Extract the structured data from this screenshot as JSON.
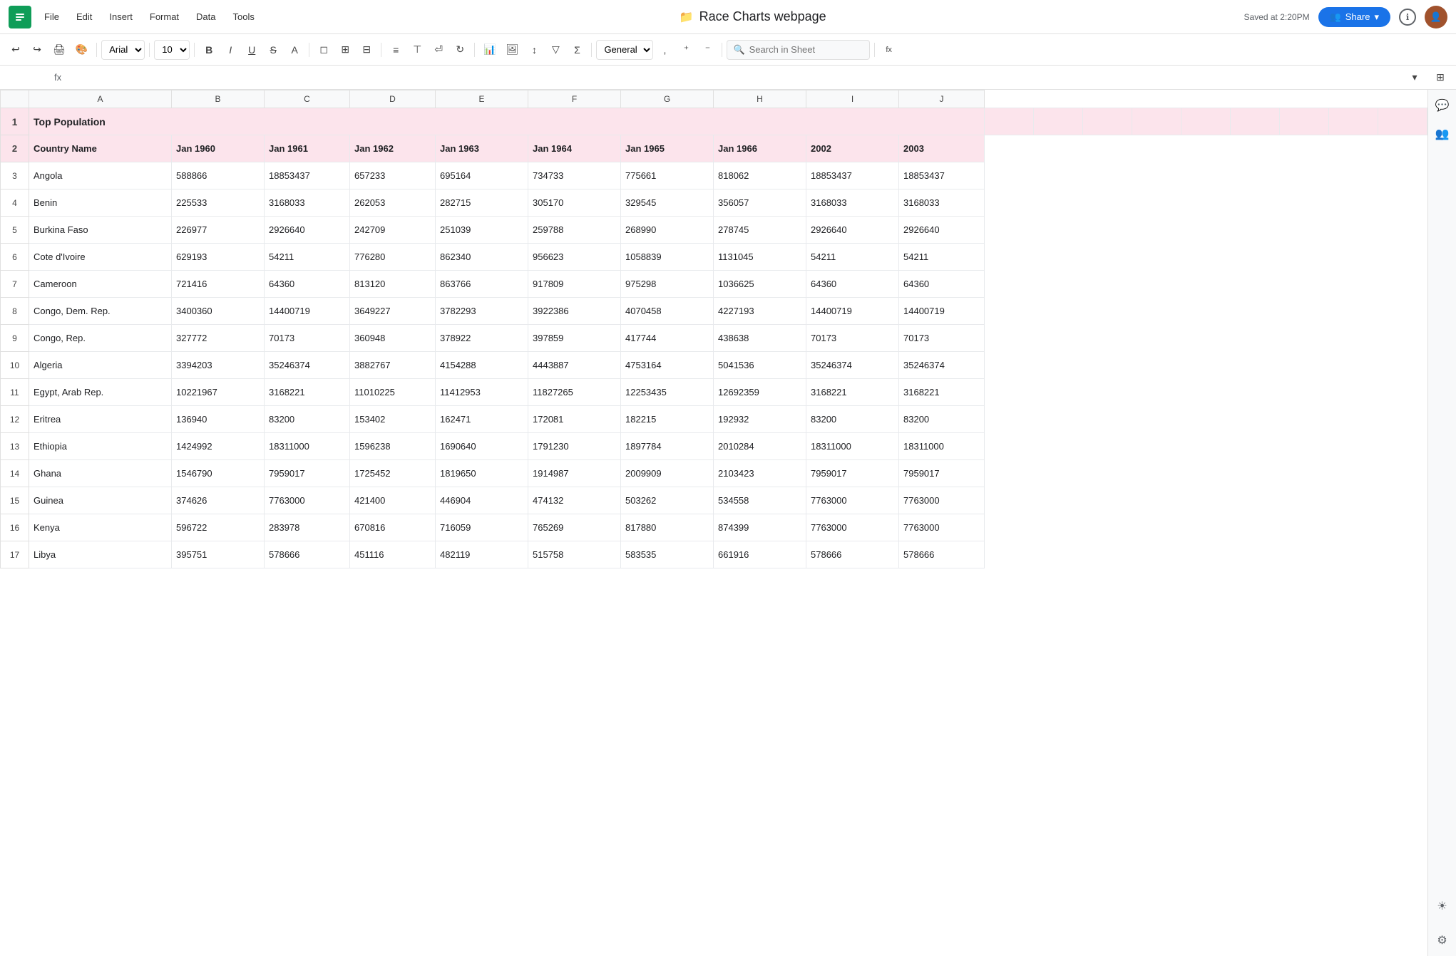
{
  "app": {
    "logo": "S",
    "menu": [
      "File",
      "Edit",
      "Insert",
      "Format",
      "Data",
      "Tools"
    ],
    "title": "Race Charts webpage",
    "saved": "Saved at 2:20PM",
    "share_label": "Share",
    "info_icon": "ℹ",
    "search_placeholder": "Search in Sheet"
  },
  "toolbar": {
    "undo": "↩",
    "redo": "↪",
    "print": "🖨",
    "paint": "🎨",
    "font": "Arial",
    "font_size": "10",
    "bold": "B",
    "italic": "I",
    "underline": "U",
    "strikethrough": "S",
    "text_color": "A",
    "fill_color": "◻",
    "borders": "⊞",
    "merge": "⊟",
    "align": "≡",
    "valign": "⊤",
    "wrap": "⏎",
    "rotate": "↻",
    "more_formats": "...",
    "filter": "▽",
    "sum": "Σ",
    "format_type": "General",
    "fx_label": "fx"
  },
  "columns": {
    "row_header": "",
    "cols": [
      "A",
      "B",
      "C",
      "D",
      "E",
      "F",
      "G",
      "H",
      "I",
      "J"
    ]
  },
  "rows": [
    {
      "row_num": "1",
      "type": "title",
      "cells": [
        "Top Population",
        "",
        "",
        "",
        "",
        "",
        "",
        "",
        "",
        ""
      ]
    },
    {
      "row_num": "2",
      "type": "header",
      "cells": [
        "Country Name",
        "Jan 1960",
        "Jan 1961",
        "Jan 1962",
        "Jan 1963",
        "Jan 1964",
        "Jan 1965",
        "Jan 1966",
        "2002",
        "2003"
      ]
    },
    {
      "row_num": "3",
      "type": "data",
      "cells": [
        "Angola",
        "588866",
        "18853437",
        "657233",
        "695164",
        "734733",
        "775661",
        "818062",
        "18853437",
        "18853437"
      ]
    },
    {
      "row_num": "4",
      "type": "data",
      "cells": [
        "Benin",
        "225533",
        "3168033",
        "262053",
        "282715",
        "305170",
        "329545",
        "356057",
        "3168033",
        "3168033"
      ]
    },
    {
      "row_num": "5",
      "type": "data",
      "cells": [
        "Burkina Faso",
        "226977",
        "2926640",
        "242709",
        "251039",
        "259788",
        "268990",
        "278745",
        "2926640",
        "2926640"
      ]
    },
    {
      "row_num": "6",
      "type": "data",
      "cells": [
        "Cote d'Ivoire",
        "629193",
        "54211",
        "776280",
        "862340",
        "956623",
        "1058839",
        "1131045",
        "54211",
        "54211"
      ]
    },
    {
      "row_num": "7",
      "type": "data",
      "cells": [
        "Cameroon",
        "721416",
        "64360",
        "813120",
        "863766",
        "917809",
        "975298",
        "1036625",
        "64360",
        "64360"
      ]
    },
    {
      "row_num": "8",
      "type": "data",
      "cells": [
        "Congo, Dem. Rep.",
        "3400360",
        "14400719",
        "3649227",
        "3782293",
        "3922386",
        "4070458",
        "4227193",
        "14400719",
        "14400719"
      ]
    },
    {
      "row_num": "9",
      "type": "data",
      "cells": [
        "Congo, Rep.",
        "327772",
        "70173",
        "360948",
        "378922",
        "397859",
        "417744",
        "438638",
        "70173",
        "70173"
      ]
    },
    {
      "row_num": "10",
      "type": "data",
      "cells": [
        "Algeria",
        "3394203",
        "35246374",
        "3882767",
        "4154288",
        "4443887",
        "4753164",
        "5041536",
        "35246374",
        "35246374"
      ]
    },
    {
      "row_num": "11",
      "type": "data",
      "cells": [
        "Egypt, Arab Rep.",
        "10221967",
        "3168221",
        "11010225",
        "11412953",
        "11827265",
        "12253435",
        "12692359",
        "3168221",
        "3168221"
      ]
    },
    {
      "row_num": "12",
      "type": "data",
      "cells": [
        "Eritrea",
        "136940",
        "83200",
        "153402",
        "162471",
        "172081",
        "182215",
        "192932",
        "83200",
        "83200"
      ]
    },
    {
      "row_num": "13",
      "type": "data",
      "cells": [
        "Ethiopia",
        "1424992",
        "18311000",
        "1596238",
        "1690640",
        "1791230",
        "1897784",
        "2010284",
        "18311000",
        "18311000"
      ]
    },
    {
      "row_num": "14",
      "type": "data",
      "cells": [
        "Ghana",
        "1546790",
        "7959017",
        "1725452",
        "1819650",
        "1914987",
        "2009909",
        "2103423",
        "7959017",
        "7959017"
      ]
    },
    {
      "row_num": "15",
      "type": "data",
      "cells": [
        "Guinea",
        "374626",
        "7763000",
        "421400",
        "446904",
        "474132",
        "503262",
        "534558",
        "7763000",
        "7763000"
      ]
    },
    {
      "row_num": "16",
      "type": "data",
      "cells": [
        "Kenya",
        "596722",
        "283978",
        "670816",
        "716059",
        "765269",
        "817880",
        "874399",
        "7763000",
        "7763000"
      ]
    },
    {
      "row_num": "17",
      "type": "data",
      "cells": [
        "Libya",
        "395751",
        "578666",
        "451116",
        "482119",
        "515758",
        "583535",
        "661916",
        "578666",
        "578666"
      ]
    }
  ]
}
